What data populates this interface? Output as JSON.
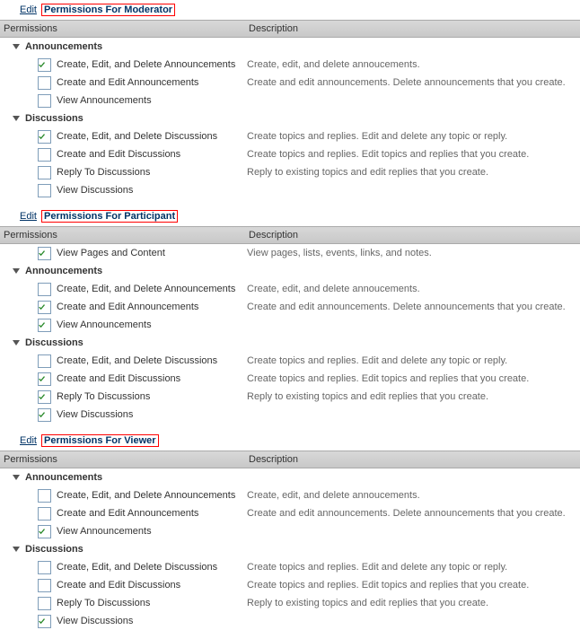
{
  "columns": {
    "permissions_header": "Permissions",
    "description_header": "Description"
  },
  "edit_label": "Edit",
  "panels": [
    {
      "title": "Permissions For Moderator",
      "groups": [
        {
          "name": "Announcements",
          "items": [
            {
              "checked": true,
              "label": "Create, Edit, and Delete Announcements",
              "desc": "Create, edit, and delete annoucements."
            },
            {
              "checked": false,
              "label": "Create and Edit Announcements",
              "desc": "Create and edit announcements. Delete announcements that you create."
            },
            {
              "checked": false,
              "label": "View Announcements",
              "desc": ""
            }
          ]
        },
        {
          "name": "Discussions",
          "items": [
            {
              "checked": true,
              "label": "Create, Edit, and Delete Discussions",
              "desc": "Create topics and replies. Edit and delete any topic or reply."
            },
            {
              "checked": false,
              "label": "Create and Edit Discussions",
              "desc": "Create topics and replies. Edit topics and replies that you create."
            },
            {
              "checked": false,
              "label": "Reply To Discussions",
              "desc": "Reply to existing topics and edit replies that you create."
            },
            {
              "checked": false,
              "label": "View Discussions",
              "desc": ""
            }
          ]
        }
      ]
    },
    {
      "title": "Permissions For Participant",
      "pre_items": [
        {
          "checked": true,
          "label": "View Pages and Content",
          "desc": "View pages, lists, events, links, and notes."
        }
      ],
      "groups": [
        {
          "name": "Announcements",
          "items": [
            {
              "checked": false,
              "label": "Create, Edit, and Delete Announcements",
              "desc": "Create, edit, and delete annoucements."
            },
            {
              "checked": true,
              "label": "Create and Edit Announcements",
              "desc": "Create and edit announcements. Delete announcements that you create."
            },
            {
              "checked": true,
              "label": "View Announcements",
              "desc": ""
            }
          ]
        },
        {
          "name": "Discussions",
          "items": [
            {
              "checked": false,
              "label": "Create, Edit, and Delete Discussions",
              "desc": "Create topics and replies. Edit and delete any topic or reply."
            },
            {
              "checked": true,
              "label": "Create and Edit Discussions",
              "desc": "Create topics and replies. Edit topics and replies that you create."
            },
            {
              "checked": true,
              "label": "Reply To Discussions",
              "desc": "Reply to existing topics and edit replies that you create."
            },
            {
              "checked": true,
              "label": "View Discussions",
              "desc": ""
            }
          ]
        }
      ]
    },
    {
      "title": "Permissions For Viewer",
      "groups": [
        {
          "name": "Announcements",
          "items": [
            {
              "checked": false,
              "label": "Create, Edit, and Delete Announcements",
              "desc": "Create, edit, and delete annoucements."
            },
            {
              "checked": false,
              "label": "Create and Edit Announcements",
              "desc": "Create and edit announcements. Delete announcements that you create."
            },
            {
              "checked": true,
              "label": "View Announcements",
              "desc": ""
            }
          ]
        },
        {
          "name": "Discussions",
          "items": [
            {
              "checked": false,
              "label": "Create, Edit, and Delete Discussions",
              "desc": "Create topics and replies. Edit and delete any topic or reply."
            },
            {
              "checked": false,
              "label": "Create and Edit Discussions",
              "desc": "Create topics and replies. Edit topics and replies that you create."
            },
            {
              "checked": false,
              "label": "Reply To Discussions",
              "desc": "Reply to existing topics and edit replies that you create."
            },
            {
              "checked": true,
              "label": "View Discussions",
              "desc": ""
            }
          ]
        }
      ]
    }
  ]
}
